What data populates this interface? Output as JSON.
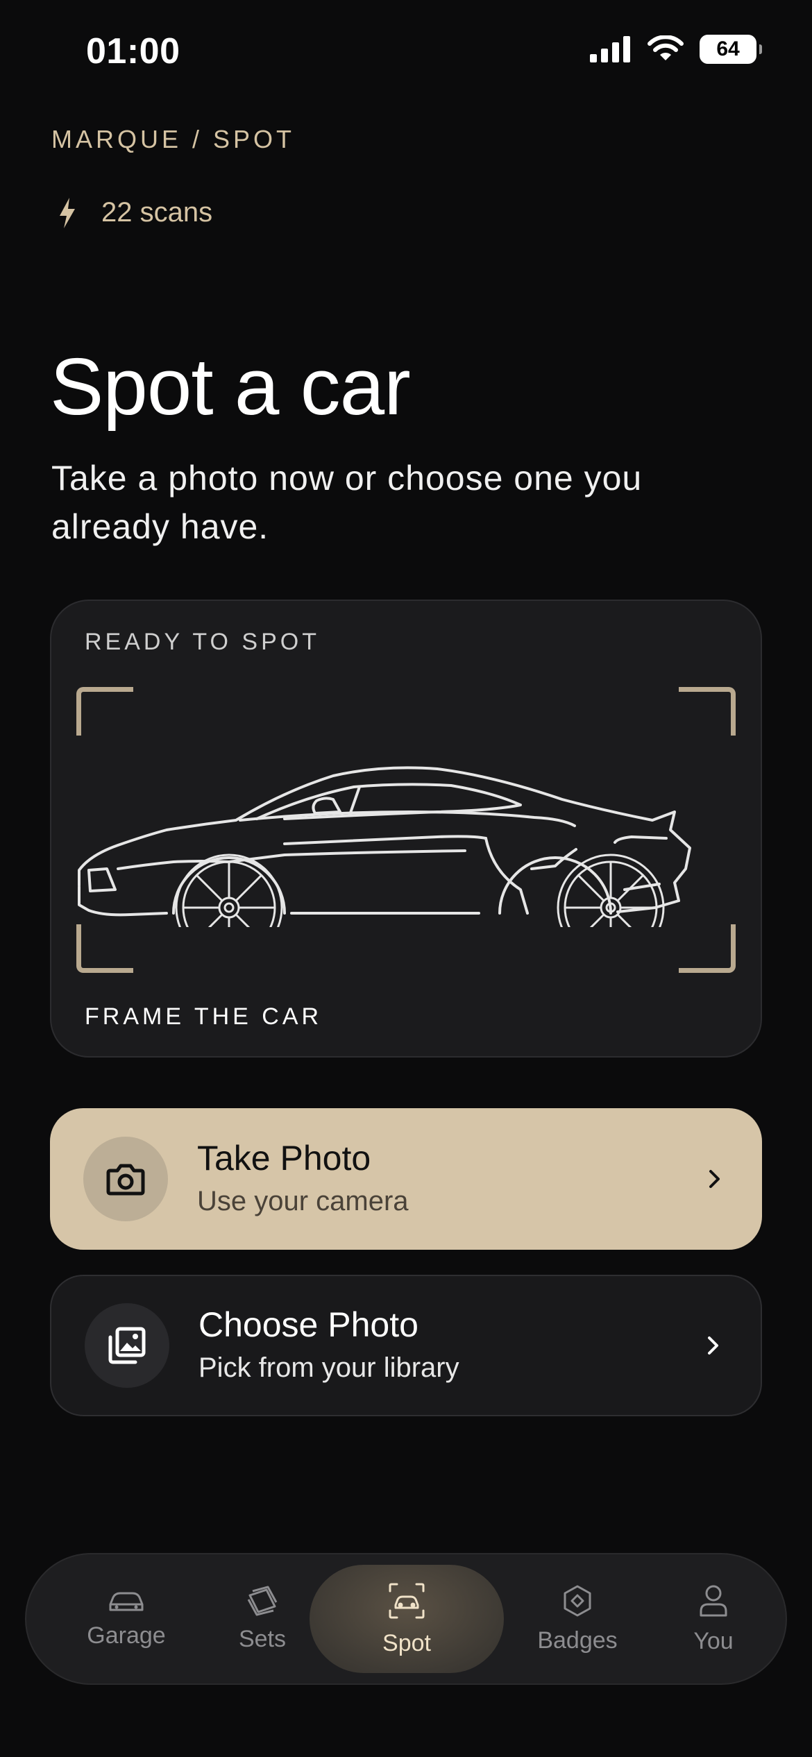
{
  "status": {
    "time": "01:00",
    "battery": "64"
  },
  "header": {
    "brand": "MARQUE / SPOT",
    "scans": "22 scans"
  },
  "main": {
    "title": "Spot a car",
    "subtitle": "Take a photo now or choose one you already have."
  },
  "card": {
    "top_label": "READY TO SPOT",
    "bottom_label": "FRAME THE CAR"
  },
  "actions": {
    "take": {
      "title": "Take Photo",
      "subtitle": "Use your camera"
    },
    "choose": {
      "title": "Choose Photo",
      "subtitle": "Pick from your library"
    }
  },
  "tabs": [
    {
      "label": "Garage",
      "icon": "car-icon"
    },
    {
      "label": "Sets",
      "icon": "stack-icon"
    },
    {
      "label": "Spot",
      "icon": "scan-car-icon",
      "active": true
    },
    {
      "label": "Badges",
      "icon": "badge-icon"
    },
    {
      "label": "You",
      "icon": "person-icon"
    }
  ],
  "colors": {
    "accent": "#d6c5a8",
    "background": "#0b0b0c",
    "card": "#1b1b1d"
  }
}
